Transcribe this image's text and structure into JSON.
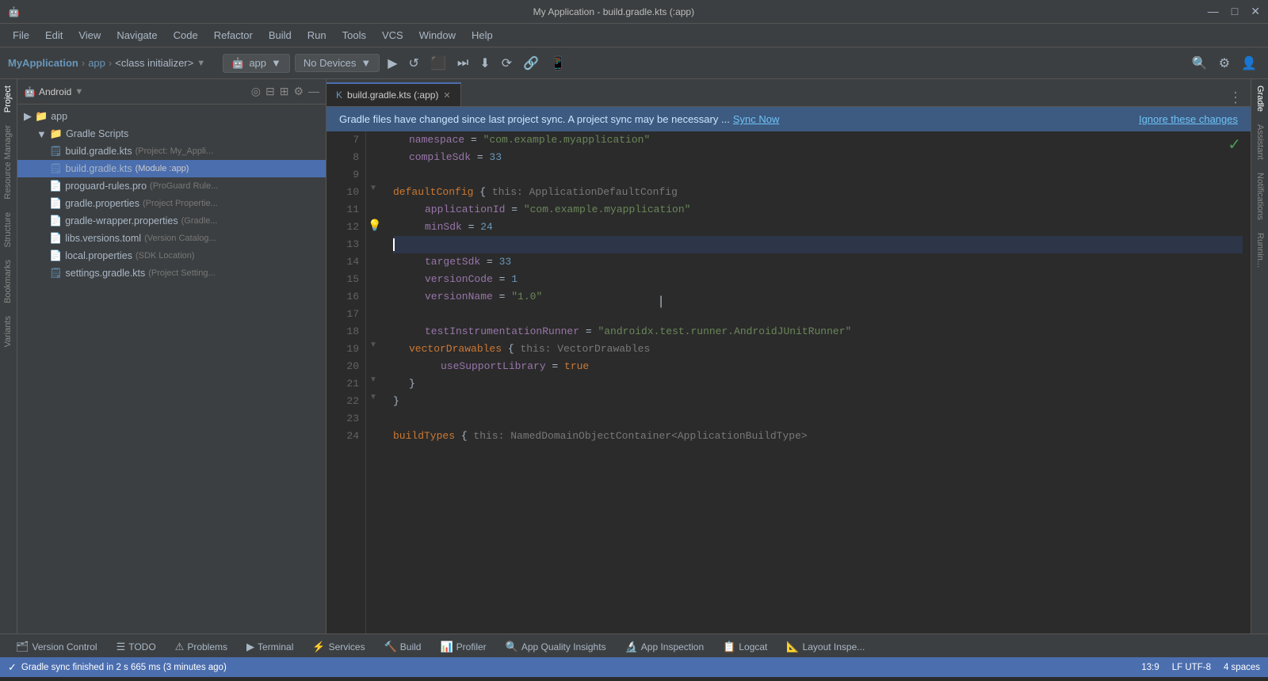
{
  "titlebar": {
    "title": "My Application - build.gradle.kts (:app)",
    "icon": "🤖",
    "minimize": "—",
    "maximize": "□",
    "close": "✕"
  },
  "menubar": {
    "items": [
      "File",
      "Edit",
      "View",
      "Navigate",
      "Code",
      "Refactor",
      "Build",
      "Run",
      "Tools",
      "VCS",
      "Window",
      "Help"
    ]
  },
  "toolbar": {
    "breadcrumb": [
      "MyApplication",
      "app",
      "<class initializer>"
    ],
    "run_config": "app",
    "device": "No Devices",
    "icons": [
      "▶",
      "↺",
      "⬛",
      "⏩",
      "⏭",
      "⬆",
      "⏬",
      "⏮",
      "🔍",
      "⚙",
      "👤"
    ]
  },
  "project_panel": {
    "label": "Android",
    "items": [
      {
        "indent": 0,
        "type": "folder",
        "name": "app",
        "meta": "",
        "selected": false,
        "expanded": true
      },
      {
        "indent": 1,
        "type": "folder",
        "name": "Gradle Scripts",
        "meta": "",
        "selected": false,
        "expanded": true
      },
      {
        "indent": 2,
        "type": "file",
        "name": "build.gradle.kts",
        "meta": "(Project: My_Appli...",
        "selected": false
      },
      {
        "indent": 2,
        "type": "file",
        "name": "build.gradle.kts",
        "meta": "(Module :app)",
        "selected": true
      },
      {
        "indent": 2,
        "type": "file",
        "name": "proguard-rules.pro",
        "meta": "(ProGuard Rule...",
        "selected": false
      },
      {
        "indent": 2,
        "type": "file",
        "name": "gradle.properties",
        "meta": "(Project Propertie...",
        "selected": false
      },
      {
        "indent": 2,
        "type": "file",
        "name": "gradle-wrapper.properties",
        "meta": "(Gradle...",
        "selected": false
      },
      {
        "indent": 2,
        "type": "file",
        "name": "libs.versions.toml",
        "meta": "(Version Catalog...",
        "selected": false
      },
      {
        "indent": 2,
        "type": "file",
        "name": "local.properties",
        "meta": "(SDK Location)",
        "selected": false
      },
      {
        "indent": 2,
        "type": "file",
        "name": "settings.gradle.kts",
        "meta": "(Project Setting...",
        "selected": false
      }
    ]
  },
  "editor": {
    "tab_label": "build.gradle.kts (:app)",
    "notification": {
      "text": "Gradle files have changed since last project sync. A project sync may be necessary ...",
      "sync_now": "Sync Now",
      "ignore": "Ignore these changes"
    },
    "lines": [
      {
        "num": 7,
        "content": "namespace_line",
        "tokens": [
          {
            "t": "prop",
            "v": "namespace"
          },
          {
            "t": "op",
            "v": " = "
          },
          {
            "t": "str",
            "v": "\"com.example.myapplication\""
          }
        ]
      },
      {
        "num": 8,
        "content": "compileSdk_line",
        "tokens": [
          {
            "t": "prop",
            "v": "compileSdk"
          },
          {
            "t": "op",
            "v": " = "
          },
          {
            "t": "num",
            "v": "33"
          }
        ]
      },
      {
        "num": 9,
        "content": "blank"
      },
      {
        "num": 10,
        "content": "defaultConfig_line",
        "tokens": [
          {
            "t": "kw",
            "v": "defaultConfig"
          },
          {
            "t": "op",
            "v": " { "
          },
          {
            "t": "hint",
            "v": "this: ApplicationDefaultConfig"
          }
        ]
      },
      {
        "num": 11,
        "content": "appId_line",
        "tokens": [
          {
            "t": "prop",
            "v": "applicationId"
          },
          {
            "t": "op",
            "v": " = "
          },
          {
            "t": "str",
            "v": "\"com.example.myapplication\""
          }
        ]
      },
      {
        "num": 12,
        "content": "minSdk_line",
        "tokens": [
          {
            "t": "prop",
            "v": "minSdk"
          },
          {
            "t": "op",
            "v": " = "
          },
          {
            "t": "num",
            "v": "24"
          }
        ],
        "bulb": true
      },
      {
        "num": 13,
        "content": "blank_active"
      },
      {
        "num": 14,
        "content": "targetSdk_line",
        "tokens": [
          {
            "t": "prop",
            "v": "targetSdk"
          },
          {
            "t": "op",
            "v": " = "
          },
          {
            "t": "num",
            "v": "33"
          }
        ]
      },
      {
        "num": 15,
        "content": "versionCode_line",
        "tokens": [
          {
            "t": "prop",
            "v": "versionCode"
          },
          {
            "t": "op",
            "v": " = "
          },
          {
            "t": "num",
            "v": "1"
          }
        ]
      },
      {
        "num": 16,
        "content": "versionName_line",
        "tokens": [
          {
            "t": "prop",
            "v": "versionName"
          },
          {
            "t": "op",
            "v": " = "
          },
          {
            "t": "str",
            "v": "\"1.0\""
          }
        ]
      },
      {
        "num": 17,
        "content": "blank"
      },
      {
        "num": 18,
        "content": "testRunner_line",
        "tokens": [
          {
            "t": "prop",
            "v": "testInstrumentationRunner"
          },
          {
            "t": "op",
            "v": " = "
          },
          {
            "t": "str",
            "v": "\"androidx.test.runner.AndroidJUnitRunner\""
          }
        ]
      },
      {
        "num": 19,
        "content": "vectorDrawables_line",
        "tokens": [
          {
            "t": "kw",
            "v": "vectorDrawables"
          },
          {
            "t": "op",
            "v": " { "
          },
          {
            "t": "hint",
            "v": "this: VectorDrawables"
          }
        ]
      },
      {
        "num": 20,
        "content": "useSupport_line",
        "tokens": [
          {
            "t": "prop",
            "v": "useSupportLibrary"
          },
          {
            "t": "op",
            "v": " = "
          },
          {
            "t": "bool",
            "v": "true"
          }
        ]
      },
      {
        "num": 21,
        "content": "close1",
        "tokens": [
          {
            "t": "op",
            "v": "    }"
          }
        ]
      },
      {
        "num": 22,
        "content": "close2",
        "tokens": [
          {
            "t": "op",
            "v": "}"
          }
        ]
      },
      {
        "num": 23,
        "content": "blank"
      },
      {
        "num": 24,
        "content": "buildTypes_line",
        "tokens": [
          {
            "t": "kw",
            "v": "buildTypes"
          },
          {
            "t": "op",
            "v": " { "
          },
          {
            "t": "hint",
            "v": "this: NamedDomainObjectContainer<ApplicationBuildType>"
          }
        ]
      }
    ]
  },
  "right_sidebar": {
    "labels": [
      "Gradle",
      "Assistant",
      "Notifications",
      "Runnin..."
    ]
  },
  "bottom_tabs": {
    "items": [
      {
        "icon": "🗂",
        "label": "Version Control"
      },
      {
        "icon": "☰",
        "label": "TODO"
      },
      {
        "icon": "⚠",
        "label": "Problems"
      },
      {
        "icon": "▶",
        "label": "Terminal"
      },
      {
        "icon": "⚡",
        "label": "Services"
      },
      {
        "icon": "🔨",
        "label": "Build"
      },
      {
        "icon": "📊",
        "label": "Profiler"
      },
      {
        "icon": "🔍",
        "label": "App Quality Insights"
      },
      {
        "icon": "🔬",
        "label": "App Inspection"
      },
      {
        "icon": "📋",
        "label": "Logcat"
      },
      {
        "icon": "📐",
        "label": "Layout Inspe..."
      }
    ]
  },
  "statusbar": {
    "sync_message": "Gradle sync finished in 2 s 665 ms (3 minutes ago)",
    "cursor_pos": "13:9",
    "encoding": "LF  UTF-8",
    "indent": "4 spaces"
  },
  "left_labels": [
    "Project",
    "Resource Manager",
    "Structure",
    "Bookmarks",
    "Variants"
  ]
}
